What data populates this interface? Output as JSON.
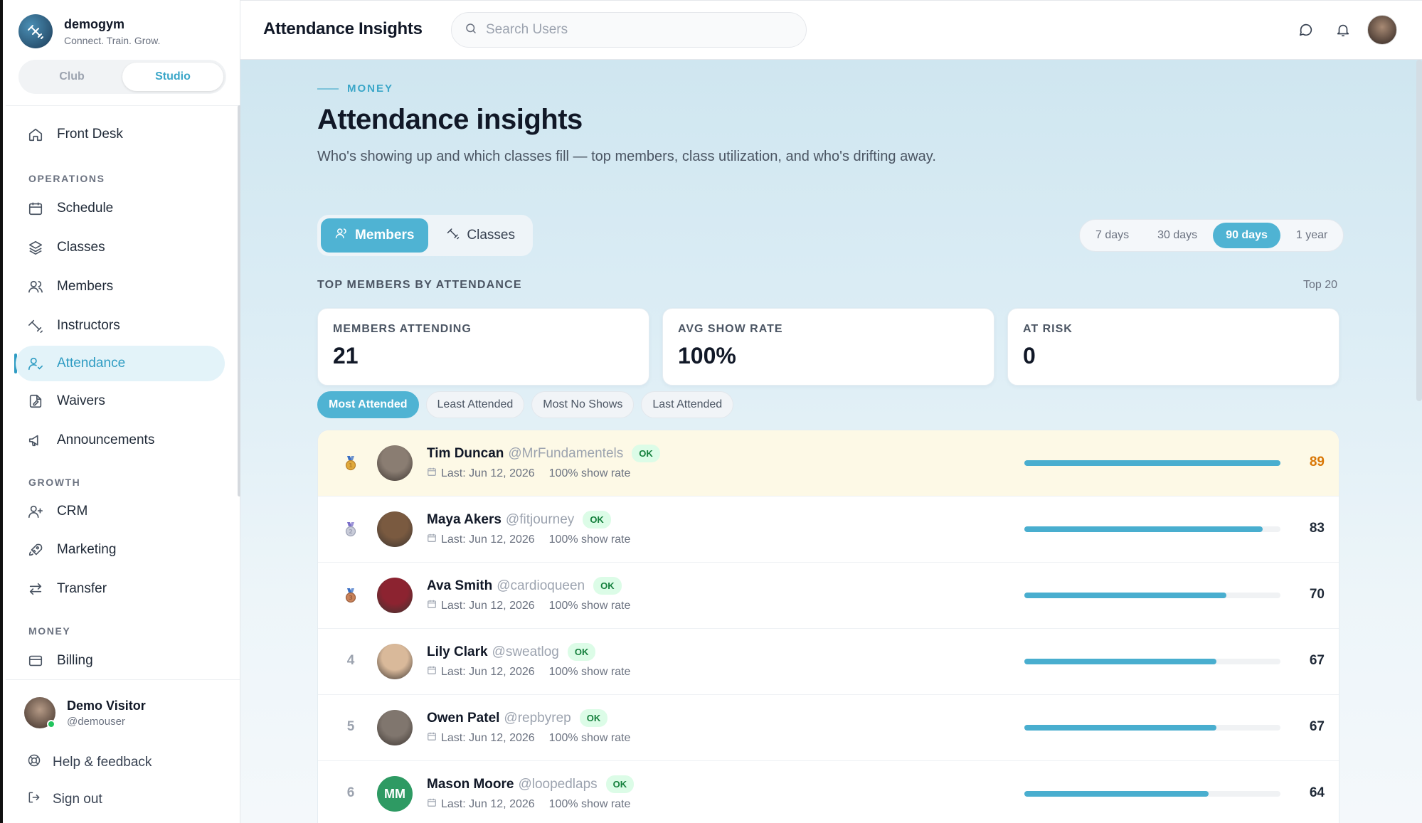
{
  "brand": {
    "name": "demogym",
    "tagline": "Connect. Train. Grow."
  },
  "switcher": {
    "options": [
      "Club",
      "Studio"
    ],
    "selected": "Studio"
  },
  "sidebar": {
    "items": [
      {
        "label": "Front Desk",
        "icon": "home-icon"
      },
      {
        "label": "Schedule",
        "icon": "calendar-icon"
      },
      {
        "label": "Classes",
        "icon": "layers-icon"
      },
      {
        "label": "Members",
        "icon": "users-icon"
      },
      {
        "label": "Instructors",
        "icon": "dumbbell-icon"
      },
      {
        "label": "Attendance",
        "icon": "user-check-icon",
        "active": true
      },
      {
        "label": "Waivers",
        "icon": "document-edit-icon"
      },
      {
        "label": "Announcements",
        "icon": "megaphone-icon"
      },
      {
        "label": "CRM",
        "icon": "user-plus-icon"
      },
      {
        "label": "Marketing",
        "icon": "rocket-icon"
      },
      {
        "label": "Transfer",
        "icon": "arrows-swap-icon"
      },
      {
        "label": "Billing",
        "icon": "credit-card-icon"
      }
    ],
    "sections": [
      "OPERATIONS",
      "GROWTH",
      "MONEY"
    ],
    "user": {
      "name": "Demo Visitor",
      "handle": "@demouser"
    },
    "help": "Help & feedback",
    "signout": "Sign out"
  },
  "topbar": {
    "title": "Attendance Insights",
    "search_placeholder": "Search Users"
  },
  "page": {
    "eyebrow": "MONEY",
    "title": "Attendance insights",
    "description": "Who's showing up and which classes fill — top members, class utilization, and who's drifting away."
  },
  "view_tabs": {
    "members": "Members",
    "classes": "Classes",
    "selected": "Members"
  },
  "ranges": {
    "options": [
      "7 days",
      "30 days",
      "90 days",
      "1 year"
    ],
    "selected": "90 days"
  },
  "section": {
    "label": "TOP MEMBERS BY ATTENDANCE",
    "right": "Top 20"
  },
  "stats": [
    {
      "label": "MEMBERS ATTENDING",
      "value": "21"
    },
    {
      "label": "AVG SHOW RATE",
      "value": "100%"
    },
    {
      "label": "AT RISK",
      "value": "0"
    }
  ],
  "filters": {
    "options": [
      "Most Attended",
      "Least Attended",
      "Most No Shows",
      "Last Attended"
    ],
    "selected": "Most Attended"
  },
  "members": [
    {
      "rank": "1",
      "name": "Tim Duncan",
      "handle": "@MrFundamentels",
      "status": "OK",
      "last": "Last: Jun 12, 2026",
      "rate": "100% show rate",
      "count": "89",
      "fill": 1.0,
      "avatar_color": "#8a7d72"
    },
    {
      "rank": "2",
      "name": "Maya Akers",
      "handle": "@fitjourney",
      "status": "OK",
      "last": "Last: Jun 12, 2026",
      "rate": "100% show rate",
      "count": "83",
      "fill": 0.93,
      "avatar_color": "#7a5a40"
    },
    {
      "rank": "3",
      "name": "Ava Smith",
      "handle": "@cardioqueen",
      "status": "OK",
      "last": "Last: Jun 12, 2026",
      "rate": "100% show rate",
      "count": "70",
      "fill": 0.79,
      "avatar_color": "#8c2330"
    },
    {
      "rank": "4",
      "name": "Lily Clark",
      "handle": "@sweatlog",
      "status": "OK",
      "last": "Last: Jun 12, 2026",
      "rate": "100% show rate",
      "count": "67",
      "fill": 0.75,
      "avatar_color": "#d9b99a"
    },
    {
      "rank": "5",
      "name": "Owen Patel",
      "handle": "@repbyrep",
      "status": "OK",
      "last": "Last: Jun 12, 2026",
      "rate": "100% show rate",
      "count": "67",
      "fill": 0.75,
      "avatar_color": "#80766e"
    },
    {
      "rank": "6",
      "name": "Mason Moore",
      "handle": "@loopedlaps",
      "status": "OK",
      "last": "Last: Jun 12, 2026",
      "rate": "100% show rate",
      "count": "64",
      "fill": 0.72,
      "avatar_color": "#2e9a63",
      "initials": "MM"
    }
  ]
}
